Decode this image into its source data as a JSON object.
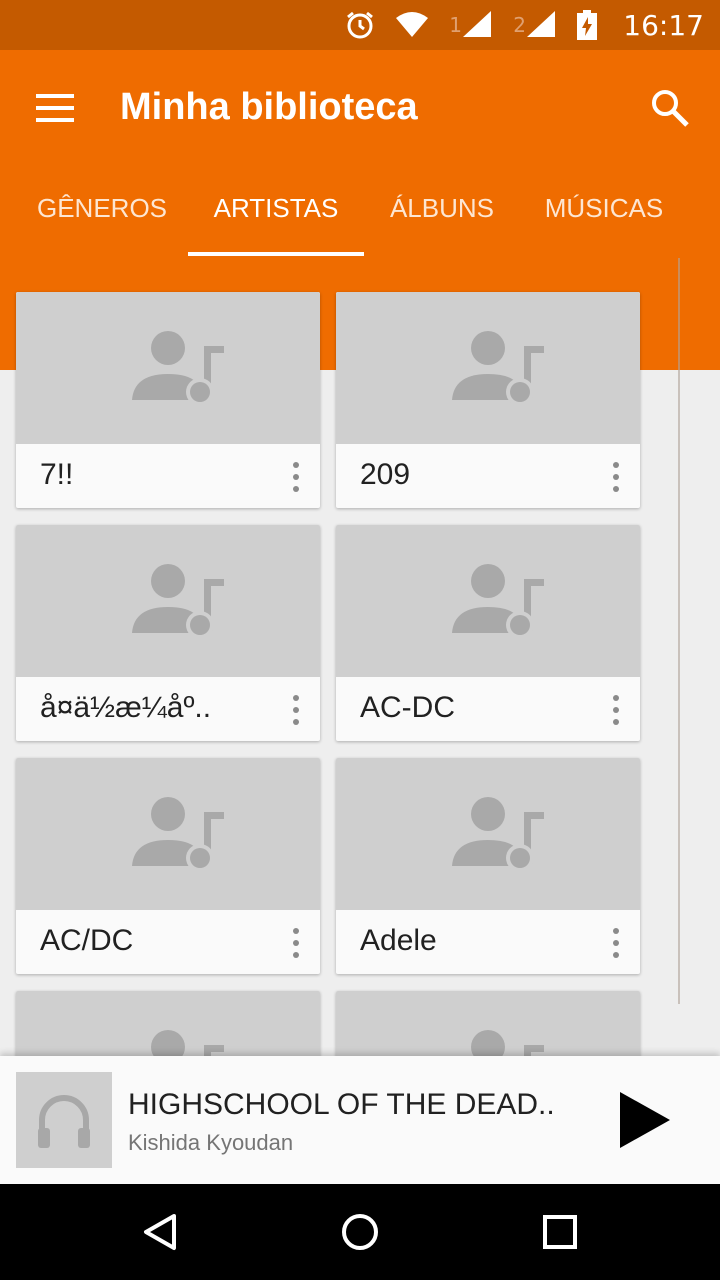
{
  "status_bar": {
    "time": "16:17",
    "sim1": "1",
    "sim2": "2",
    "icons": [
      "alarm-icon",
      "wifi-icon",
      "signal-icon",
      "signal-icon",
      "battery-charging-icon"
    ]
  },
  "app_bar": {
    "title": "Minha biblioteca",
    "menu_icon": "menu-icon",
    "search_icon": "search-icon",
    "color": "#ef6c00"
  },
  "tabs": [
    {
      "label": "GÊNEROS",
      "active": false
    },
    {
      "label": "ARTISTAS",
      "active": true
    },
    {
      "label": "ÁLBUNS",
      "active": false
    },
    {
      "label": "MÚSICAS",
      "active": false
    }
  ],
  "artists": [
    {
      "name": "7!!"
    },
    {
      "name": "209"
    },
    {
      "name": "å¤ä½æ¼åº.."
    },
    {
      "name": "AC-DC"
    },
    {
      "name": "AC/DC"
    },
    {
      "name": "Adele"
    },
    {
      "name": ""
    },
    {
      "name": ""
    }
  ],
  "now_playing": {
    "title": "HIGHSCHOOL OF THE DEAD..",
    "artist": "Kishida Kyoudan",
    "thumb_icon": "headphones-icon",
    "play_icon": "play-icon"
  },
  "nav_bar": {
    "icons": [
      "back-icon",
      "home-icon",
      "recents-icon"
    ]
  }
}
